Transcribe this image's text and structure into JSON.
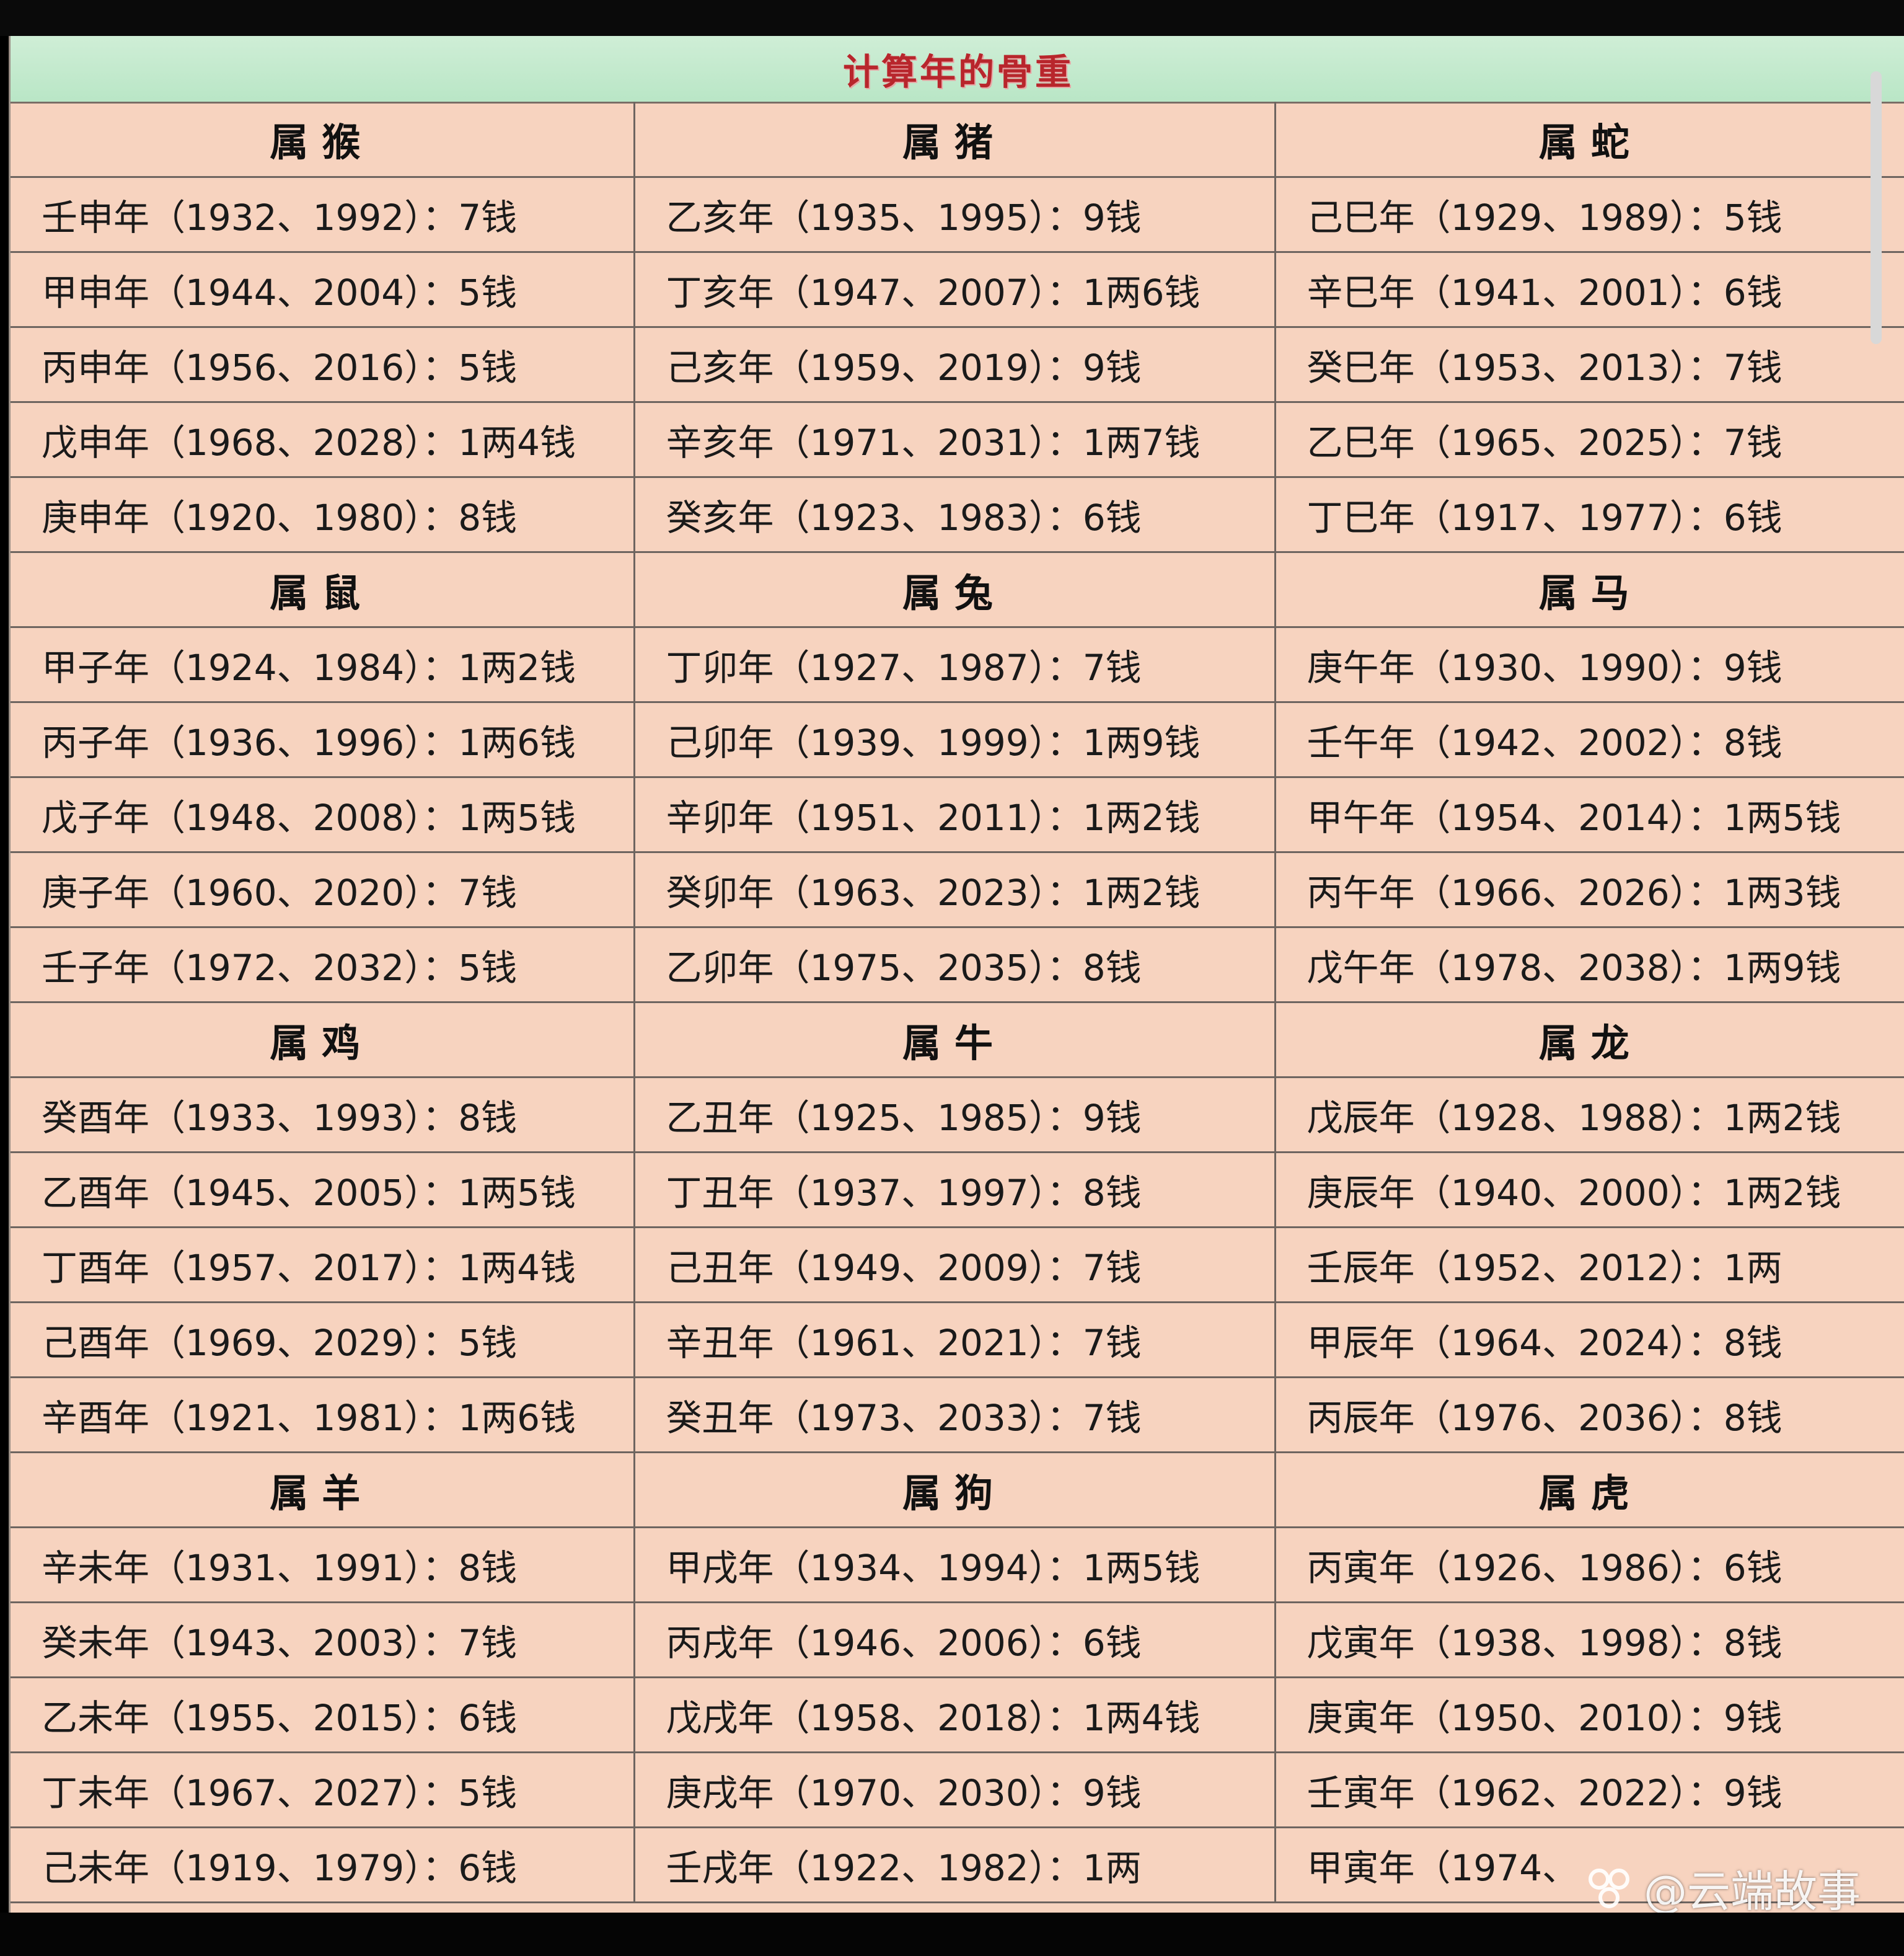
{
  "title": "计算年的骨重",
  "watermark": "@云端故事",
  "columns": 3,
  "blocks": [
    {
      "heads": [
        "属猴",
        "属猪",
        "属蛇"
      ],
      "rows": [
        [
          "壬申年（1932、1992）：7钱",
          "乙亥年（1935、1995）：9钱",
          "己巳年（1929、1989）：5钱"
        ],
        [
          "甲申年（1944、2004）：5钱",
          "丁亥年（1947、2007）：1两6钱",
          "辛巳年（1941、2001）：6钱"
        ],
        [
          "丙申年（1956、2016）：5钱",
          "己亥年（1959、2019）：9钱",
          "癸巳年（1953、2013）：7钱"
        ],
        [
          "戊申年（1968、2028）：1两4钱",
          "辛亥年（1971、2031）：1两7钱",
          "乙巳年（1965、2025）：7钱"
        ],
        [
          "庚申年（1920、1980）：8钱",
          "癸亥年（1923、1983）：6钱",
          "丁巳年（1917、1977）：6钱"
        ]
      ]
    },
    {
      "heads": [
        "属鼠",
        "属兔",
        "属马"
      ],
      "rows": [
        [
          "甲子年（1924、1984）：1两2钱",
          "丁卯年（1927、1987）：7钱",
          "庚午年（1930、1990）：9钱"
        ],
        [
          "丙子年（1936、1996）：1两6钱",
          "己卯年（1939、1999）：1两9钱",
          "壬午年（1942、2002）：8钱"
        ],
        [
          "戊子年（1948、2008）：1两5钱",
          "辛卯年（1951、2011）：1两2钱",
          "甲午年（1954、2014）：1两5钱"
        ],
        [
          "庚子年（1960、2020）：7钱",
          "癸卯年（1963、2023）：1两2钱",
          "丙午年（1966、2026）：1两3钱"
        ],
        [
          "壬子年（1972、2032）：5钱",
          "乙卯年（1975、2035）：8钱",
          "戊午年（1978、2038）：1两9钱"
        ]
      ]
    },
    {
      "heads": [
        "属鸡",
        "属牛",
        "属龙"
      ],
      "rows": [
        [
          "癸酉年（1933、1993）：8钱",
          "乙丑年（1925、1985）：9钱",
          "戊辰年（1928、1988）：1两2钱"
        ],
        [
          "乙酉年（1945、2005）：1两5钱",
          "丁丑年（1937、1997）：8钱",
          "庚辰年（1940、2000）：1两2钱"
        ],
        [
          "丁酉年（1957、2017）：1两4钱",
          "己丑年（1949、2009）：7钱",
          "壬辰年（1952、2012）：1两"
        ],
        [
          "己酉年（1969、2029）：5钱",
          "辛丑年（1961、2021）：7钱",
          "甲辰年（1964、2024）：8钱"
        ],
        [
          "辛酉年（1921、1981）：1两6钱",
          "癸丑年（1973、2033）：7钱",
          "丙辰年（1976、2036）：8钱"
        ]
      ]
    },
    {
      "heads": [
        "属羊",
        "属狗",
        "属虎"
      ],
      "rows": [
        [
          "辛未年（1931、1991）：8钱",
          "甲戌年（1934、1994）：1两5钱",
          "丙寅年（1926、1986）：6钱"
        ],
        [
          "癸未年（1943、2003）：7钱",
          "丙戌年（1946、2006）：6钱",
          "戊寅年（1938、1998）：8钱"
        ],
        [
          "乙未年（1955、2015）：6钱",
          "戊戌年（1958、2018）：1两4钱",
          "庚寅年（1950、2010）：9钱"
        ],
        [
          "丁未年（1967、2027）：5钱",
          "庚戌年（1970、2030）：9钱",
          "壬寅年（1962、2022）：9钱"
        ],
        [
          "己未年（1919、1979）：6钱",
          "壬戌年（1922、1982）：1两",
          "甲寅年（1974、"
        ]
      ]
    }
  ]
}
